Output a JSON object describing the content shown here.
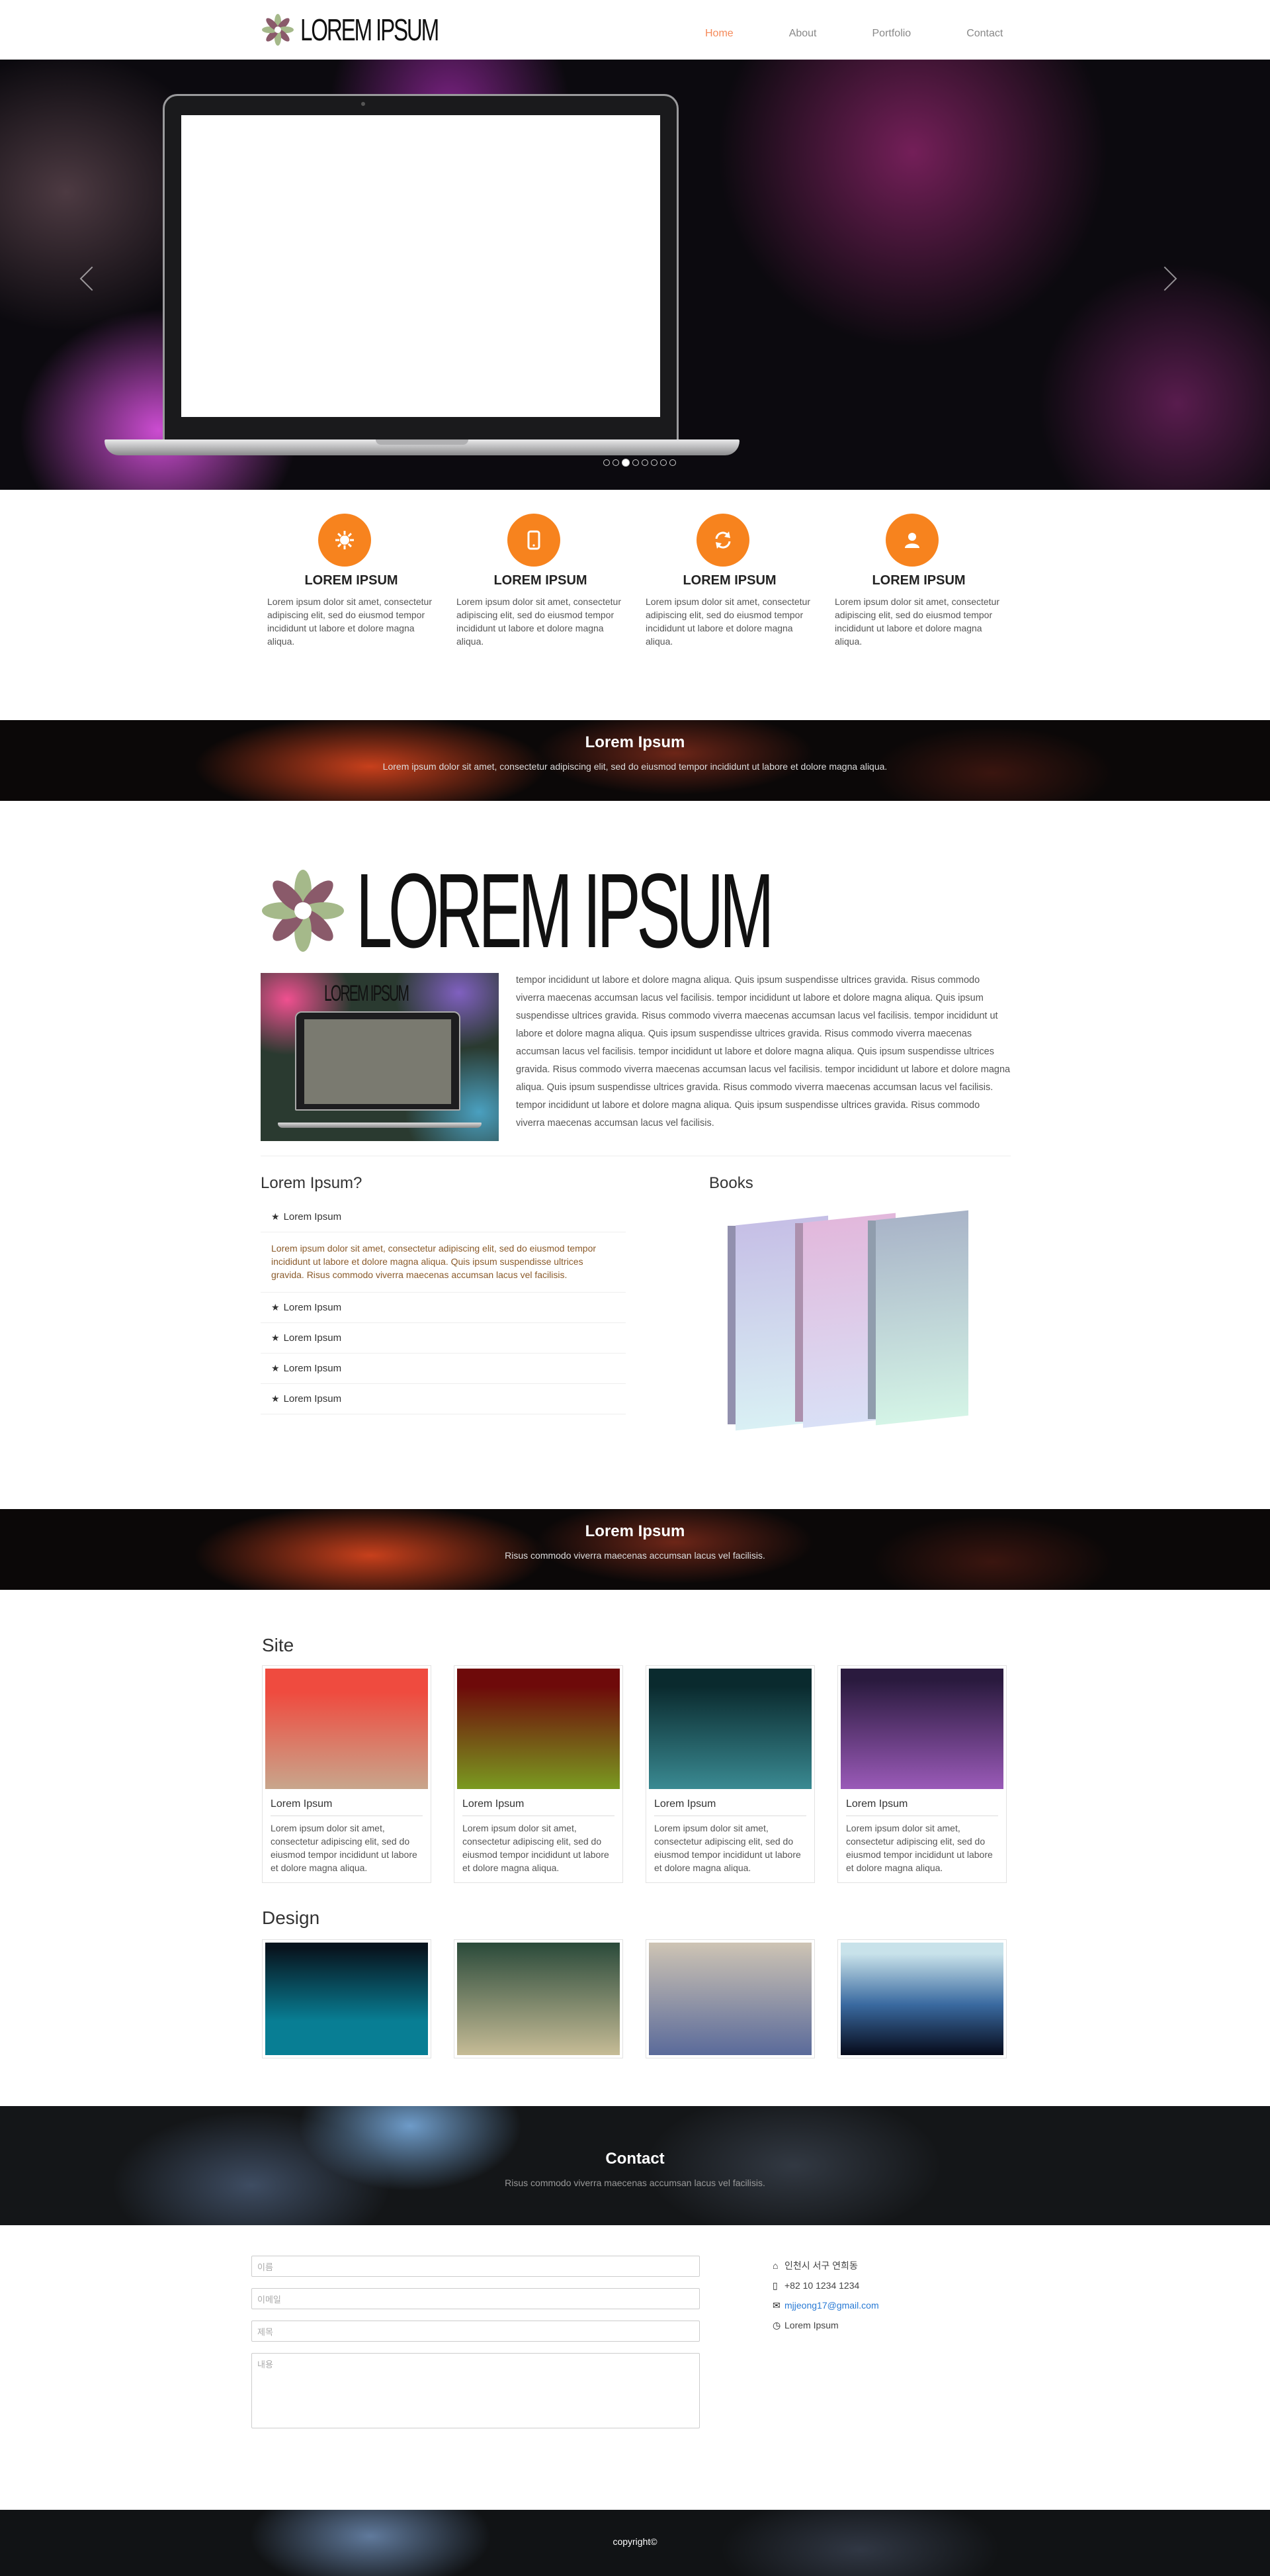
{
  "nav": {
    "logo_text": "LOREM IPSUM",
    "menu": [
      "Home",
      "About",
      "Portfolio",
      "Contact"
    ],
    "accent": "#f58a5a"
  },
  "hero": {
    "slide_count": 8,
    "active_slide": 3
  },
  "features": [
    {
      "icon": "sun-icon",
      "title": "LOREM IPSUM",
      "text": "Lorem ipsum dolor sit amet, consectetur adipiscing elit, sed do eiusmod tempor incididunt ut labore et dolore magna aliqua."
    },
    {
      "icon": "phone-icon",
      "title": "LOREM IPSUM",
      "text": "Lorem ipsum dolor sit amet, consectetur adipiscing elit, sed do eiusmod tempor incididunt ut labore et dolore magna aliqua."
    },
    {
      "icon": "refresh-icon",
      "title": "LOREM IPSUM",
      "text": "Lorem ipsum dolor sit amet, consectetur adipiscing elit, sed do eiusmod tempor incididunt ut labore et dolore magna aliqua."
    },
    {
      "icon": "user-icon",
      "title": "LOREM IPSUM",
      "text": "Lorem ipsum dolor sit amet, consectetur adipiscing elit, sed do eiusmod tempor incididunt ut labore et dolore magna aliqua."
    }
  ],
  "banner1": {
    "title": "Lorem Ipsum",
    "text": "Lorem ipsum dolor sit amet, consectetur adipiscing elit, sed do eiusmod tempor incididunt ut labore et dolore magna aliqua."
  },
  "about": {
    "logo_text": "LOREM IPSUM",
    "image_logo": "LOREM IPSUM",
    "paragraph": "tempor incididunt ut labore et dolore magna aliqua. Quis ipsum suspendisse ultrices gravida. Risus commodo viverra maecenas accumsan lacus vel facilisis. tempor incididunt ut labore et dolore magna aliqua. Quis ipsum suspendisse ultrices gravida. Risus commodo viverra maecenas accumsan lacus vel facilisis. tempor incididunt ut labore et dolore magna aliqua. Quis ipsum suspendisse ultrices gravida. Risus commodo viverra maecenas accumsan lacus vel facilisis. tempor incididunt ut labore et dolore magna aliqua. Quis ipsum suspendisse ultrices gravida. Risus commodo viverra maecenas accumsan lacus vel facilisis. tempor incididunt ut labore et dolore magna aliqua. Quis ipsum suspendisse ultrices gravida. Risus commodo viverra maecenas accumsan lacus vel facilisis. tempor incididunt ut labore et dolore magna aliqua. Quis ipsum suspendisse ultrices gravida. Risus commodo viverra maecenas accumsan lacus vel facilisis."
  },
  "faq": {
    "title": "Lorem Ipsum?",
    "items": [
      "Lorem Ipsum",
      "Lorem Ipsum",
      "Lorem Ipsum",
      "Lorem Ipsum",
      "Lorem Ipsum"
    ],
    "open_body": "Lorem ipsum dolor sit amet, consectetur adipiscing elit, sed do eiusmod tempor incididunt ut labore et dolore magna aliqua. Quis ipsum suspendisse ultrices gravida. Risus commodo viverra maecenas accumsan lacus vel facilisis."
  },
  "books": {
    "title": "Books"
  },
  "banner2": {
    "title": "Lorem Ipsum",
    "text": "Risus commodo viverra maecenas accumsan lacus vel facilisis."
  },
  "site": {
    "title": "Site",
    "cards": [
      {
        "title": "Lorem Ipsum",
        "text": "Lorem ipsum dolor sit amet, consectetur adipiscing elit, sed do eiusmod tempor incididunt ut labore et dolore magna aliqua."
      },
      {
        "title": "Lorem Ipsum",
        "text": "Lorem ipsum dolor sit amet, consectetur adipiscing elit, sed do eiusmod tempor incididunt ut labore et dolore magna aliqua."
      },
      {
        "title": "Lorem Ipsum",
        "text": "Lorem ipsum dolor sit amet, consectetur adipiscing elit, sed do eiusmod tempor incididunt ut labore et dolore magna aliqua."
      },
      {
        "title": "Lorem Ipsum",
        "text": "Lorem ipsum dolor sit amet, consectetur adipiscing elit, sed do eiusmod tempor incididunt ut labore et dolore magna aliqua."
      }
    ]
  },
  "design": {
    "title": "Design"
  },
  "contact": {
    "title": "Contact",
    "text": "Risus commodo viverra maecenas accumsan lacus vel facilisis.",
    "form": {
      "name_placeholder": "이름",
      "email_placeholder": "이메일",
      "subject_placeholder": "제목",
      "message_placeholder": "내용"
    },
    "info": {
      "address": "인천시 서구 연희동",
      "phone": "+82 10 1234 1234",
      "email": "mjjeong17@gmail.com",
      "other": "Lorem Ipsum"
    }
  },
  "footer": {
    "text": "copyright©"
  }
}
